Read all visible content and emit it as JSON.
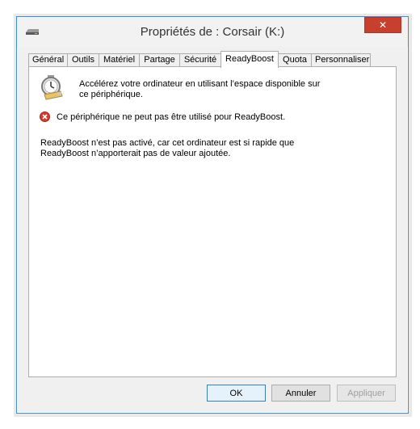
{
  "window": {
    "title": "Propriétés de : Corsair (K:)",
    "close_label": "✕"
  },
  "tabs": [
    {
      "label": "Général"
    },
    {
      "label": "Outils"
    },
    {
      "label": "Matériel"
    },
    {
      "label": "Partage"
    },
    {
      "label": "Sécurité"
    },
    {
      "label": "ReadyBoost",
      "active": true
    },
    {
      "label": "Quota"
    },
    {
      "label": "Personnaliser"
    }
  ],
  "panel": {
    "intro_text": "Accélérez votre ordinateur en utilisant l’espace disponible sur ce périphérique.",
    "error_text": "Ce périphérique ne peut pas être utilisé pour ReadyBoost.",
    "info_text": "ReadyBoost n’est pas activé, car cet ordinateur est si rapide que ReadyBoost n’apporterait pas de valeur ajoutée."
  },
  "buttons": {
    "ok": "OK",
    "cancel": "Annuler",
    "apply": "Appliquer"
  },
  "colors": {
    "close_button": "#c7402f",
    "window_border": "#3d8fd3",
    "error": "#d23c2f"
  },
  "icons": {
    "title": "drive-icon",
    "panel": "readyboost-icon",
    "error": "error-icon"
  }
}
